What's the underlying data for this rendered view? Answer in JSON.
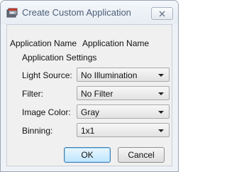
{
  "window": {
    "title": "Create Custom Application",
    "close_label": "✕"
  },
  "form": {
    "app_name_label": "Application Name",
    "app_name_value": "Application Name",
    "settings_label": "Application Settings",
    "fields": [
      {
        "label": "Light Source:",
        "value": "No Illumination"
      },
      {
        "label": "Filter:",
        "value": "No Filter"
      },
      {
        "label": "Image Color:",
        "value": "Gray"
      },
      {
        "label": "Binning:",
        "value": "1x1"
      }
    ]
  },
  "buttons": {
    "ok": "OK",
    "cancel": "Cancel"
  },
  "colors": {
    "title_text": "#4d5f78",
    "default_button_border": "#3c7fb1"
  },
  "icons": {
    "app": "app-window-icon",
    "close": "close-icon",
    "dropdown": "chevron-down-icon"
  }
}
